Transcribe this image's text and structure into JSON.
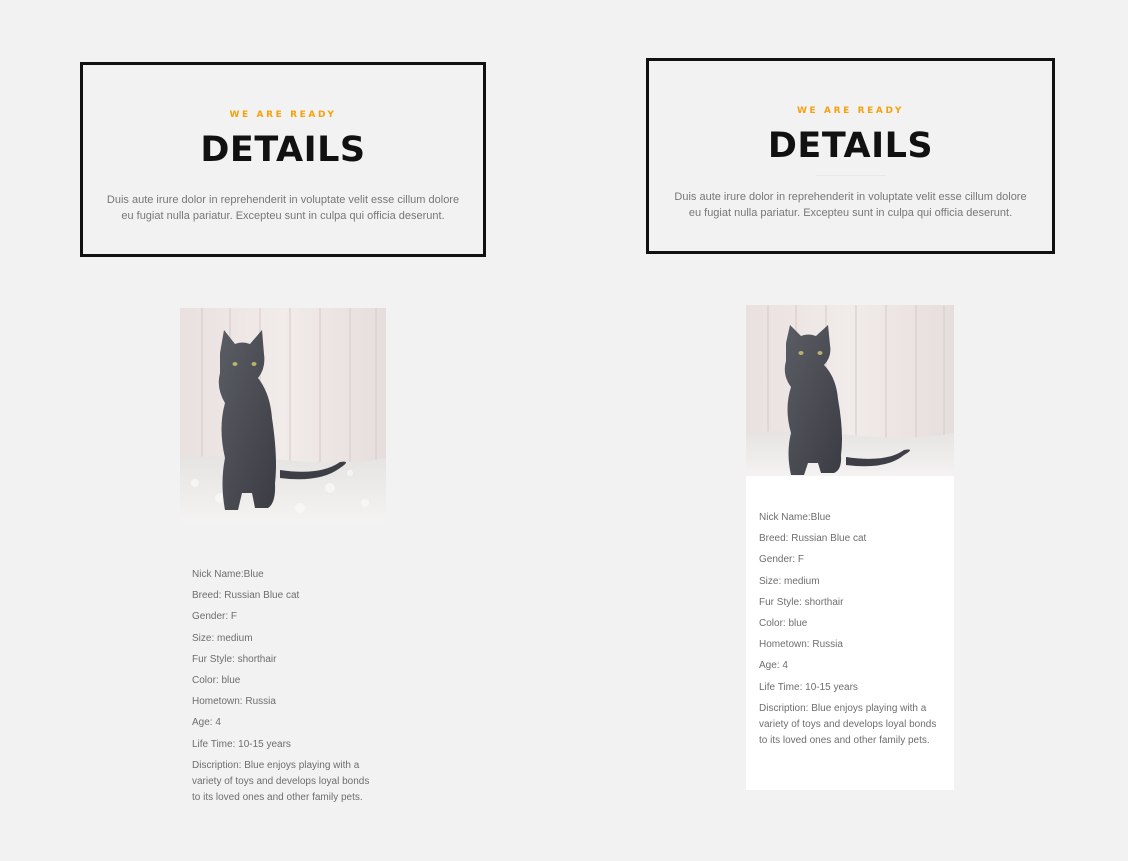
{
  "panels": [
    {
      "hero": {
        "eyebrow": "WE ARE READY",
        "title": "DETAILS",
        "description": "Duis aute irure dolor in reprehenderit in voluptate velit esse cillum dolore eu fugiat nulla pariatur. Excepteu sunt in culpa qui officia deserunt."
      },
      "details": {
        "nickname": "Nick Name:Blue",
        "breed": "Breed: Russian Blue cat",
        "gender": "Gender: F",
        "size": "Size: medium",
        "fur_style": "Fur Style: shorthair",
        "color": "Color: blue",
        "hometown": "Hometown: Russia",
        "age": "Age: 4",
        "life_time": "Life Time: 10-15 years",
        "description": "Discription: Blue enjoys playing with a variety of toys and develops loyal bonds to its loved ones and other family pets."
      }
    },
    {
      "hero": {
        "eyebrow": "WE ARE READY",
        "title": "DETAILS",
        "description": "Duis aute irure dolor in reprehenderit in voluptate velit esse cillum dolore eu fugiat nulla pariatur. Excepteu sunt in culpa qui officia deserunt."
      },
      "details": {
        "nickname": "Nick Name:Blue",
        "breed": "Breed: Russian Blue cat",
        "gender": "Gender: F",
        "size": "Size: medium",
        "fur_style": "Fur Style: shorthair",
        "color": "Color: blue",
        "hometown": "Hometown: Russia",
        "age": "Age: 4",
        "life_time": "Life Time: 10-15 years",
        "description": "Discription: Blue enjoys playing with a variety of toys and develops loyal bonds to its loved ones and other family pets."
      }
    }
  ],
  "colors": {
    "accent": "#f4a20c",
    "background": "#f2f2f2",
    "border": "#111111",
    "card": "#ffffff",
    "text_muted": "#6e6e6e"
  },
  "images": {
    "pet_photo": "russian-blue-cat-photo"
  }
}
